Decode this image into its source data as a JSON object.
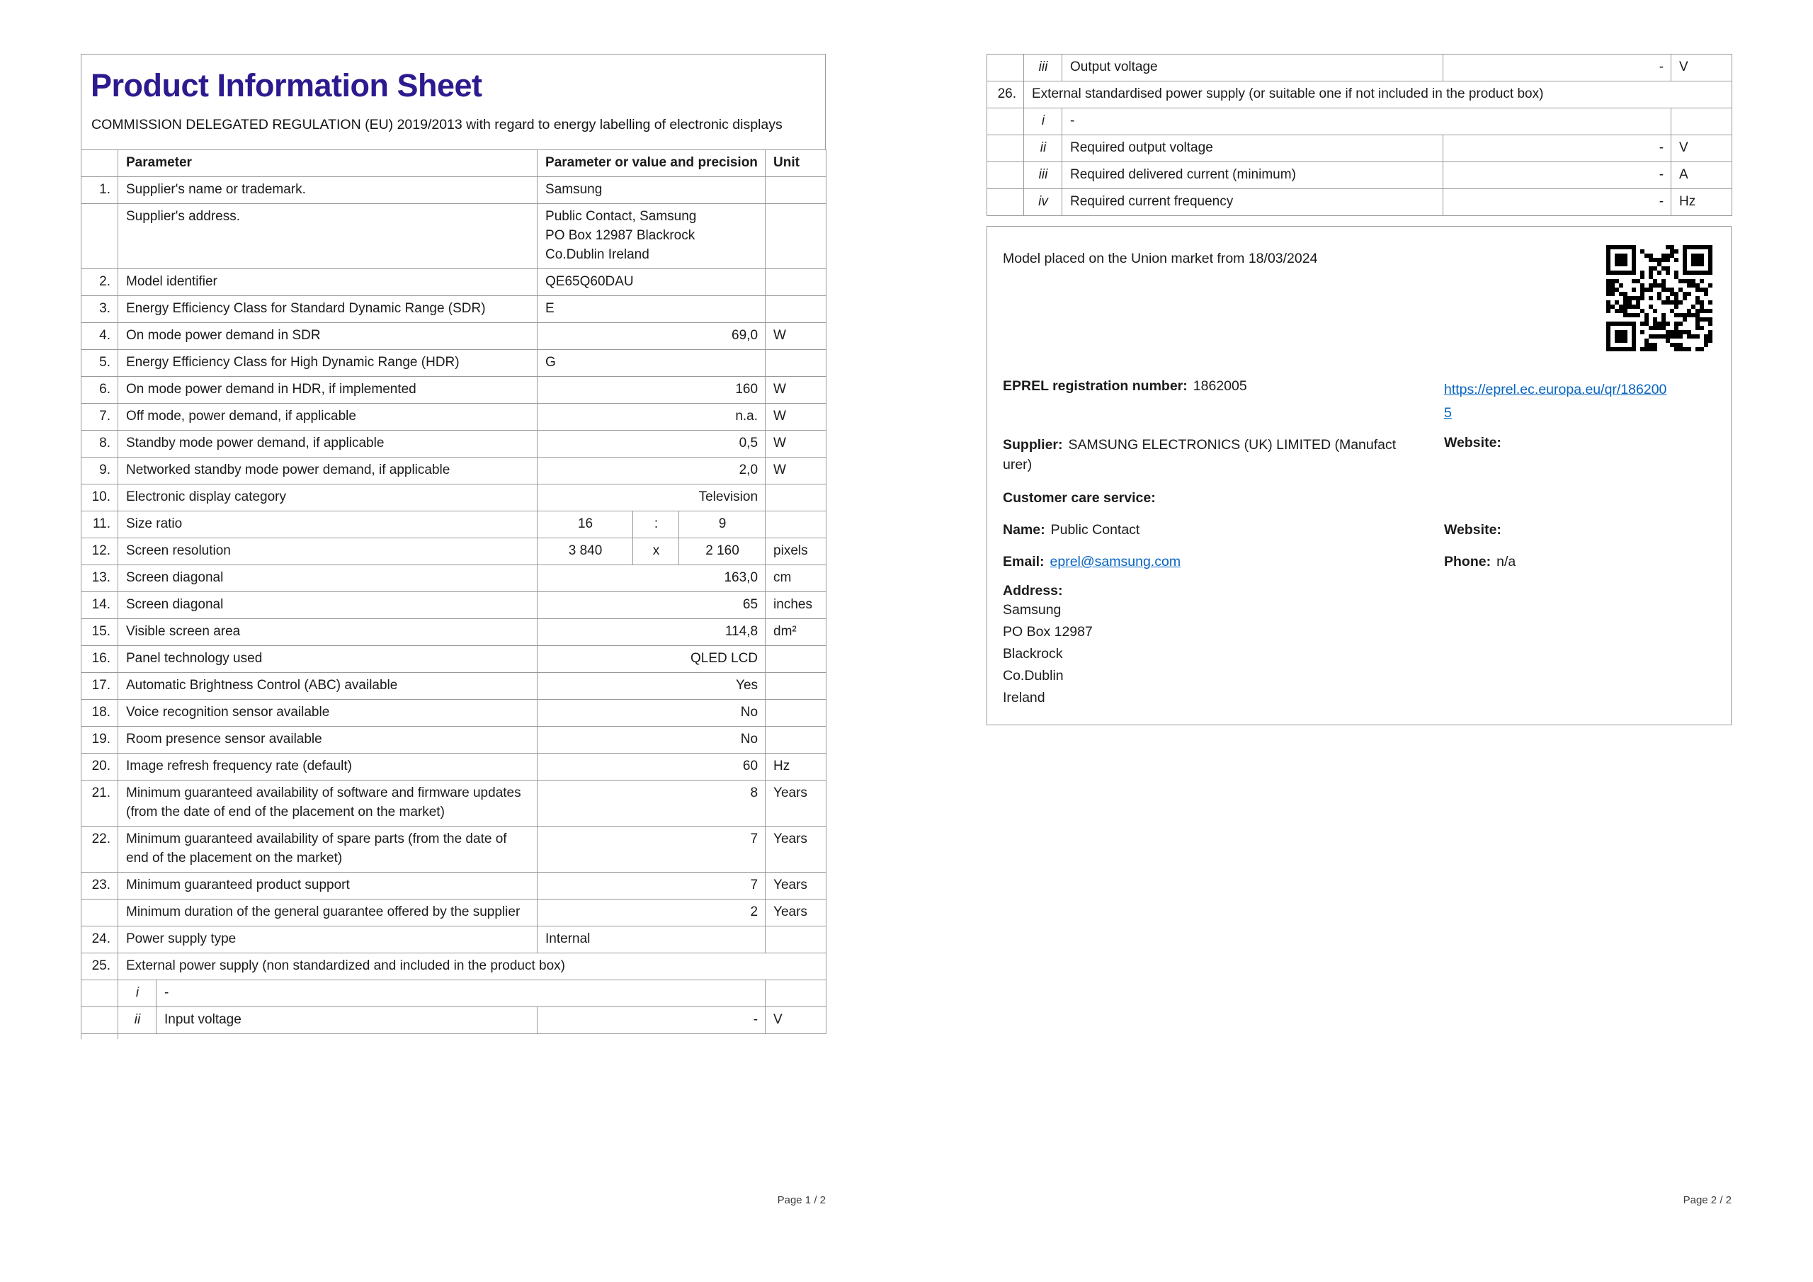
{
  "colors": {
    "title": "#2E1A8F",
    "link": "#0563C1",
    "border": "#999999"
  },
  "icons": {
    "qr_code": "qr-code"
  },
  "page1": {
    "title": "Product Information Sheet",
    "subtitle": "COMMISSION DELEGATED REGULATION (EU) 2019/2013 with regard to energy labelling of electronic displays",
    "header": {
      "parameter": "Parameter",
      "value": "Parameter or value and precision",
      "unit": "Unit"
    },
    "footer": "Page 1 / 2",
    "rows": [
      {
        "type": "normal",
        "num": "1.",
        "label": "Supplier's name or trademark.",
        "value": "Samsung",
        "unit": "",
        "align": "left"
      },
      {
        "type": "normal",
        "num": "",
        "label": "Supplier's address.",
        "value": [
          "Public Contact, Samsung",
          "PO Box 12987 Blackrock",
          "Co.Dublin Ireland"
        ],
        "unit": "",
        "align": "left"
      },
      {
        "type": "normal",
        "num": "2.",
        "label": "Model identifier",
        "value": "QE65Q60DAU",
        "unit": "",
        "align": "left"
      },
      {
        "type": "normal",
        "num": "3.",
        "label": "Energy Efficiency Class for Standard Dynamic Range (SDR)",
        "value": "E",
        "unit": "",
        "align": "left"
      },
      {
        "type": "normal",
        "num": "4.",
        "label": "On mode power demand in SDR",
        "value": "69,0",
        "unit": "W",
        "align": "right"
      },
      {
        "type": "normal",
        "num": "5.",
        "label": "Energy Efficiency Class for High Dynamic Range (HDR)",
        "value": "G",
        "unit": "",
        "align": "left"
      },
      {
        "type": "normal",
        "num": "6.",
        "label": "On mode power demand in HDR, if implemented",
        "value": "160",
        "unit": "W",
        "align": "right"
      },
      {
        "type": "normal",
        "num": "7.",
        "label": "Off mode, power demand, if applicable",
        "value": "n.a.",
        "unit": "W",
        "align": "right"
      },
      {
        "type": "normal",
        "num": "8.",
        "label": "Standby mode power demand, if applicable",
        "value": "0,5",
        "unit": "W",
        "align": "right"
      },
      {
        "type": "normal",
        "num": "9.",
        "label": "Networked standby mode power demand, if applic­able",
        "value": "2,0",
        "unit": "W",
        "align": "right"
      },
      {
        "type": "normal",
        "num": "10.",
        "label": "Electronic display category",
        "value": "Television",
        "unit": "",
        "align": "right"
      },
      {
        "type": "split3",
        "num": "11.",
        "label": "Size ratio",
        "v1": "16",
        "sep": ":",
        "v2": "9",
        "unit": ""
      },
      {
        "type": "split3",
        "num": "12.",
        "label": "Screen resolution",
        "v1": "3 840",
        "sep": "x",
        "v2": "2 160",
        "unit": "pixels"
      },
      {
        "type": "normal",
        "num": "13.",
        "label": "Screen diagonal",
        "value": "163,0",
        "unit": "cm",
        "align": "right"
      },
      {
        "type": "normal",
        "num": "14.",
        "label": "Screen diagonal",
        "value": "65",
        "unit": "inches",
        "align": "right"
      },
      {
        "type": "normal",
        "num": "15.",
        "label": "Visible screen area",
        "value": "114,8",
        "unit": "dm²",
        "align": "right"
      },
      {
        "type": "normal",
        "num": "16.",
        "label": "Panel technology used",
        "value": "QLED LCD",
        "unit": "",
        "align": "right"
      },
      {
        "type": "normal",
        "num": "17.",
        "label": "Automatic Brightness Control (ABC) available",
        "value": "Yes",
        "unit": "",
        "align": "right"
      },
      {
        "type": "normal",
        "num": "18.",
        "label": "Voice recognition sensor available",
        "value": "No",
        "unit": "",
        "align": "right"
      },
      {
        "type": "normal",
        "num": "19.",
        "label": "Room presence sensor available",
        "value": "No",
        "unit": "",
        "align": "right"
      },
      {
        "type": "normal",
        "num": "20.",
        "label": "Image refresh frequency rate (default)",
        "value": "60",
        "unit": "Hz",
        "align": "right"
      },
      {
        "type": "normal",
        "num": "21.",
        "label": "Minimum guaranteed availability of software and firmware updates (from the date of end of the placement on the market)",
        "value": "8",
        "unit": "Years",
        "align": "right"
      },
      {
        "type": "normal",
        "num": "22.",
        "label": "Minimum guaranteed availability of spare parts (from the date of end of the placement on the mar­ket)",
        "value": "7",
        "unit": "Years",
        "align": "right"
      },
      {
        "type": "normal",
        "num": "23.",
        "label": "Minimum guaranteed product support",
        "value": "7",
        "unit": "Years",
        "align": "right"
      },
      {
        "type": "normal",
        "num": "",
        "label": "Minimum duration of the general guarantee offered by the supplier",
        "value": "2",
        "unit": "Years",
        "align": "right"
      },
      {
        "type": "normal",
        "num": "24.",
        "label": "Power supply type",
        "value": "Internal",
        "unit": "",
        "align": "left"
      },
      {
        "type": "span",
        "num": "25.",
        "label": "External power supply (non standardized and included in the product box)"
      },
      {
        "type": "subspan",
        "sub": "i",
        "label": "-"
      },
      {
        "type": "subnormal",
        "sub": "ii",
        "label": "Input voltage",
        "value": "-",
        "unit": "V",
        "align": "right"
      }
    ]
  },
  "page2": {
    "footer": "Page 2 / 2",
    "rows": [
      {
        "type": "subnormal",
        "sub": "iii",
        "label": "Output voltage",
        "value": "-",
        "unit": "V",
        "align": "right"
      },
      {
        "type": "span",
        "num": "26.",
        "label": "External standardised power supply (or suitable one if not included in the product box)"
      },
      {
        "type": "subspan",
        "sub": "i",
        "label": "-"
      },
      {
        "type": "subnormal",
        "sub": "ii",
        "label": "Required output voltage",
        "value": "-",
        "unit": "V",
        "align": "right"
      },
      {
        "type": "subnormal",
        "sub": "iii",
        "label": "Required delivered current (minimum)",
        "value": "-",
        "unit": "A",
        "align": "right"
      },
      {
        "type": "subnormal",
        "sub": "iv",
        "label": "Required current frequency",
        "value": "-",
        "unit": "Hz",
        "align": "right"
      }
    ],
    "info": {
      "market_line": "Model placed on the Union market from 18/03/2024",
      "eprel_label": "EPREL registration number:",
      "eprel_value": "1862005",
      "eprel_link": "https://eprel.ec.europa.eu/qr/1862005",
      "supplier_label": "Supplier:",
      "supplier_value": "SAMSUNG ELECTRONICS (UK) LIMITED (Manufacturer)",
      "website_label": "Website:",
      "customer_care_label": "Customer care service:",
      "name_label": "Name:",
      "name_value": "Public Contact",
      "website2_label": "Website:",
      "email_label": "Email:",
      "email_value": "eprel@samsung.com",
      "phone_label": "Phone:",
      "phone_value": "n/a",
      "address_label": "Address:",
      "address_lines": [
        "Samsung",
        "PO Box 12987",
        "Blackrock",
        "Co.Dublin",
        "Ireland"
      ]
    }
  }
}
